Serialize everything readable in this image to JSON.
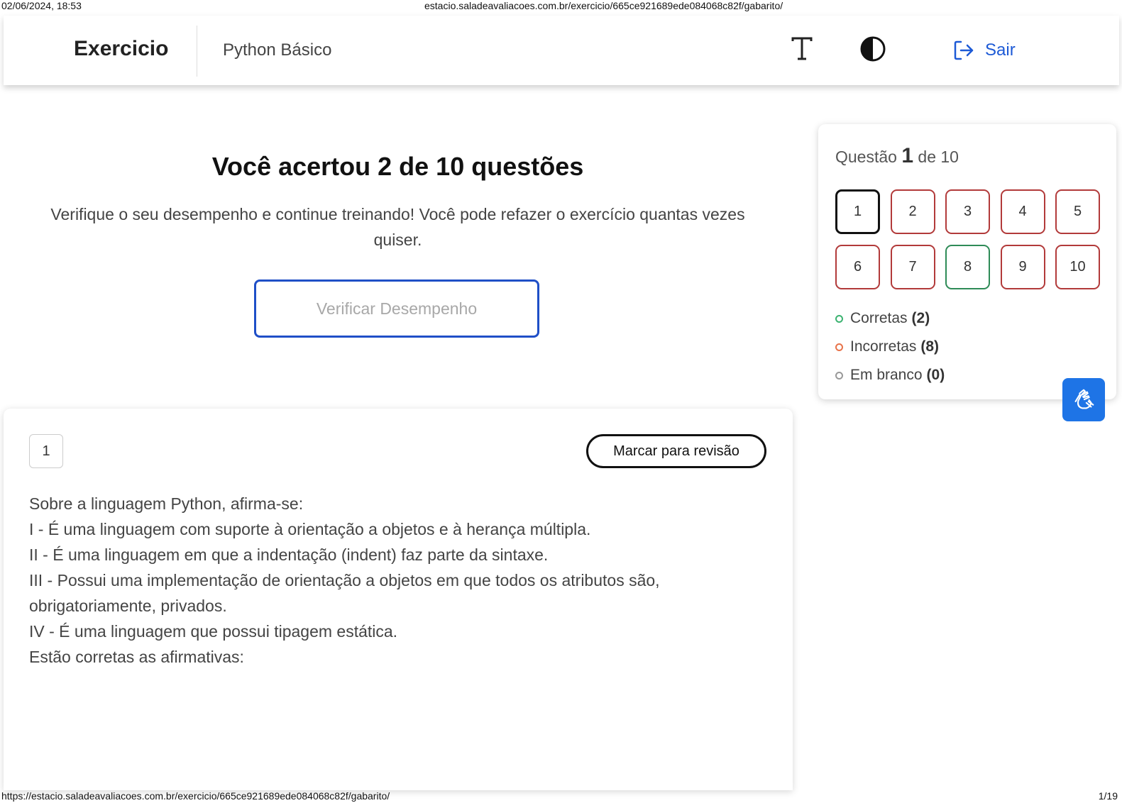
{
  "print": {
    "datetime": "02/06/2024, 18:53",
    "header_url": "estacio.saladeavaliacoes.com.br/exercicio/665ce921689ede084068c82f/gabarito/",
    "footer_url": "https://estacio.saladeavaliacoes.com.br/exercicio/665ce921689ede084068c82f/gabarito/",
    "page": "1/19"
  },
  "topbar": {
    "brand": "Exercicio",
    "course": "Python Básico",
    "font_icon": "font-size-icon",
    "contrast_icon": "contrast-icon",
    "logout_icon": "logout-icon",
    "logout_label": "Sair",
    "accent_color": "#1d5ad6"
  },
  "result": {
    "title": "Você acertou 2 de 10 questões",
    "description": "Verifique o seu desempenho e continue treinando! Você pode refazer o exercício quantas vezes quiser.",
    "verify_button": "Verificar Desempenho"
  },
  "side_panel": {
    "question_label": "Questão",
    "current": "1",
    "total_label": "de 10",
    "questions": [
      {
        "n": "1",
        "status": "current"
      },
      {
        "n": "2",
        "status": "incorrect"
      },
      {
        "n": "3",
        "status": "incorrect"
      },
      {
        "n": "4",
        "status": "incorrect"
      },
      {
        "n": "5",
        "status": "incorrect"
      },
      {
        "n": "6",
        "status": "incorrect"
      },
      {
        "n": "7",
        "status": "incorrect"
      },
      {
        "n": "8",
        "status": "correct"
      },
      {
        "n": "9",
        "status": "incorrect"
      },
      {
        "n": "10",
        "status": "incorrect"
      }
    ],
    "legend": [
      {
        "label": "Corretas",
        "count": "(2)",
        "color": "#3cb371"
      },
      {
        "label": "Incorretas",
        "count": "(8)",
        "color": "#e8734a"
      },
      {
        "label": "Em branco",
        "count": "(0)",
        "color": "#999999"
      }
    ],
    "colors": {
      "correct": "#2e8b57",
      "incorrect": "#b23a3a",
      "current": "#111111"
    }
  },
  "accessibility": {
    "icon": "sign-language-icon",
    "color": "#1e74e6"
  },
  "question": {
    "number": "1",
    "review_button": "Marcar para revisão",
    "lines": [
      "Sobre a linguagem Python, afirma-se:",
      "I - É uma linguagem com suporte à orientação a objetos e à herança múltipla.",
      "II - É uma linguagem em que a indentação (indent) faz parte da sintaxe.",
      "III - Possui uma implementação de orientação a objetos em que todos os atributos são, obrigatoriamente, privados.",
      "IV - É uma linguagem que possui tipagem estática.",
      "Estão corretas as afirmativas:"
    ]
  }
}
